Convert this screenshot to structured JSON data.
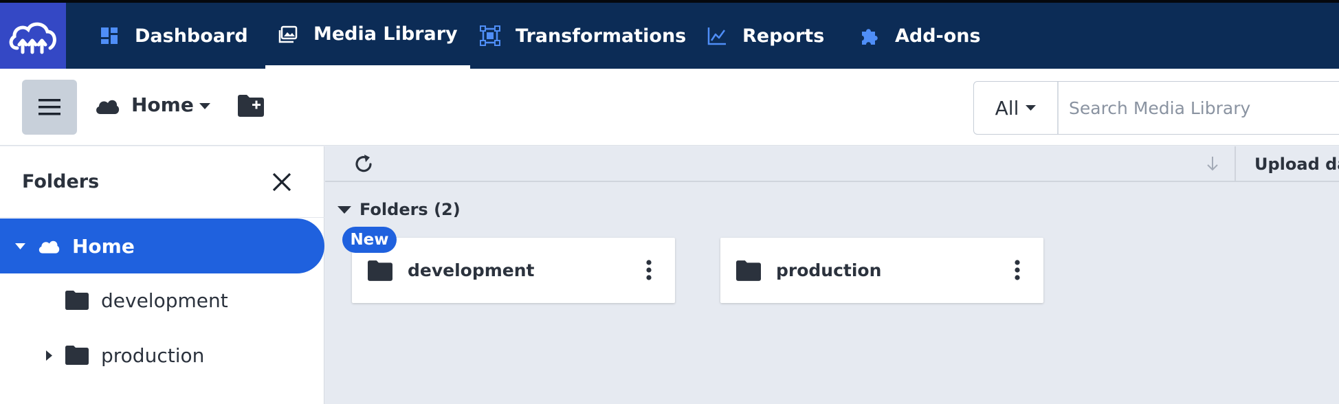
{
  "nav": {
    "items": [
      {
        "label": "Dashboard",
        "icon": "dashboard-icon"
      },
      {
        "label": "Media Library",
        "icon": "media-library-icon",
        "active": true
      },
      {
        "label": "Transformations",
        "icon": "transformations-icon"
      },
      {
        "label": "Reports",
        "icon": "reports-icon"
      },
      {
        "label": "Add-ons",
        "icon": "puzzle-icon"
      }
    ],
    "colors": {
      "bar": "#0c2c56",
      "logo_bg": "#3448c5",
      "icon_accent": "#4f8ef7"
    }
  },
  "toolbar": {
    "breadcrumb_label": "Home",
    "search": {
      "filter_label": "All",
      "placeholder": "Search Media Library"
    }
  },
  "sidebar": {
    "title": "Folders",
    "tree": [
      {
        "label": "Home",
        "selected": true,
        "expanded": true
      },
      {
        "label": "development",
        "has_children": false
      },
      {
        "label": "production",
        "has_children": true
      }
    ],
    "selected_color": "#1f61de"
  },
  "main": {
    "column_header": "Upload date",
    "section_label": "Folders (2)",
    "folders": [
      {
        "name": "development",
        "badge": "New"
      },
      {
        "name": "production"
      }
    ]
  }
}
